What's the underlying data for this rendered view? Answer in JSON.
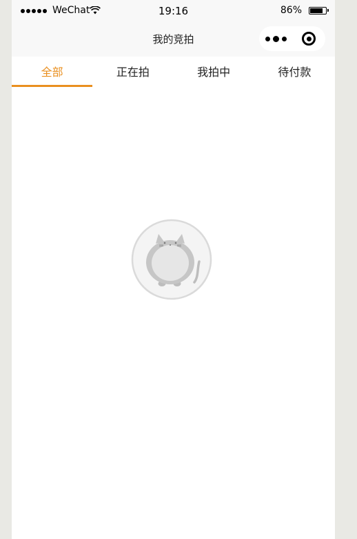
{
  "status_bar": {
    "carrier": "WeChat",
    "time": "19:16",
    "battery": "86%"
  },
  "nav": {
    "title": "我的竞拍",
    "more_icon": "more-icon",
    "close_icon": "close-icon"
  },
  "tabs": [
    {
      "label": "全部",
      "active": true
    },
    {
      "label": "正在拍",
      "active": false
    },
    {
      "label": "我拍中",
      "active": false
    },
    {
      "label": "待付款",
      "active": false
    }
  ],
  "empty_state": {
    "icon": "cat-icon"
  },
  "colors": {
    "accent": "#e98f1f",
    "background": "#e9e9e4",
    "bar": "#f8f8f8"
  }
}
